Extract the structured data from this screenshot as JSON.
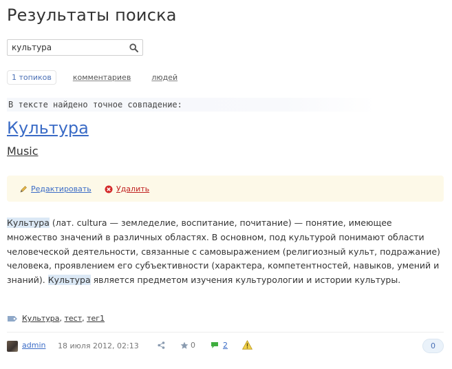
{
  "page": {
    "title": "Результаты поиска"
  },
  "search": {
    "value": "культура"
  },
  "tabs": [
    {
      "label": "1 топиков",
      "active": true
    },
    {
      "label": "комментариев",
      "active": false
    },
    {
      "label": "людей",
      "active": false
    }
  ],
  "match_notice": "В тексте найдено точное совпадение:",
  "topic": {
    "title": "Культура",
    "blog": "Music",
    "actions": {
      "edit_label": "Редактировать",
      "delete_label": "Удалить"
    },
    "text": {
      "hl1": "Культура",
      "part1": " (лат. cultura — земледелие, воспитание, почитание) — понятие, имеющее множество значений в различных областях. В основном, под культурой понимают области человеческой деятельности, связанные с самовыражением (религиозный культ, подражание) человека, проявлением его субъективности (характера, компетентностей, навыков, умений и знаний). ",
      "hl2": "Культура",
      "part2": " является предметом изучения культурологии и истории культуры."
    },
    "tags": [
      "Культура",
      "тест",
      "тег1"
    ],
    "footer": {
      "author": "admin",
      "date": "18 июля 2012, 02:13",
      "favourites": "0",
      "comments": "2",
      "rating": "0"
    }
  },
  "colors": {
    "link": "#3a6bc6",
    "delete": "#c02020",
    "highlight": "#dbe8f5",
    "actions_bg": "#fdf9e8"
  },
  "icons": [
    "search-icon",
    "pencil-icon",
    "delete-icon",
    "tag-icon",
    "share-icon",
    "star-icon",
    "comment-icon",
    "warning-icon"
  ]
}
